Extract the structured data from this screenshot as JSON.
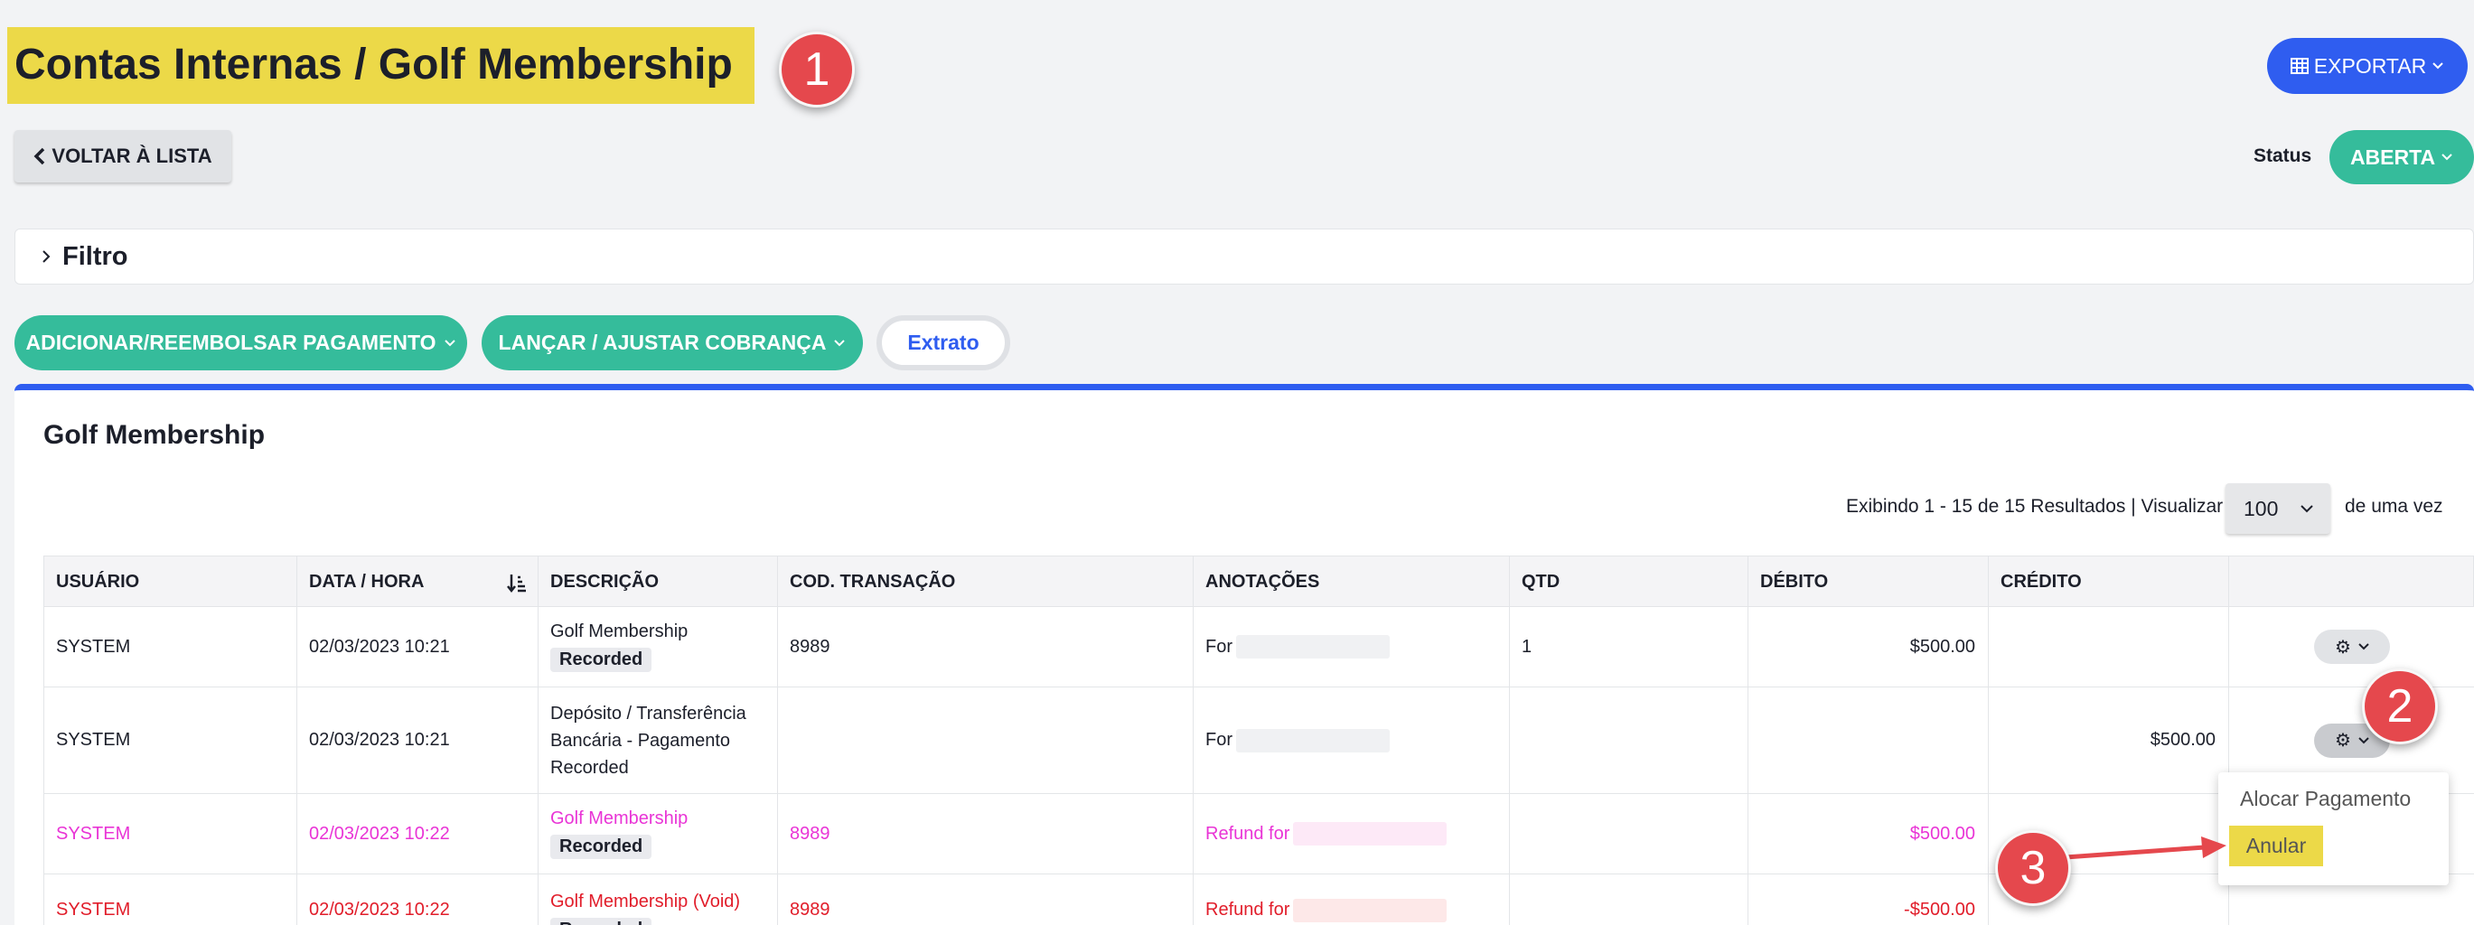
{
  "header": {
    "title": "Contas Internas  / Golf Membership",
    "export_label": "EXPORTAR",
    "back_label": "VOLTAR À LISTA",
    "status_label": "Status",
    "status_value": "ABERTA"
  },
  "filter": {
    "label": "Filtro"
  },
  "actions": {
    "add_payment": "ADICIONAR/REEMBOLSAR PAGAMENTO",
    "post_charge": "LANÇAR / AJUSTAR COBRANÇA",
    "statement": "Extrato"
  },
  "panel": {
    "title": "Golf Membership",
    "pager_text": "Exibindo 1 - 15 de 15 Resultados |  Visualizar",
    "per_page": "100",
    "per_page_suffix": "de uma vez"
  },
  "table": {
    "headers": [
      "USUÁRIO",
      "DATA / HORA",
      "DESCRIÇÃO",
      "COD. TRANSAÇÃO",
      "ANOTAÇÕES",
      "QTD",
      "DÉBITO",
      "CRÉDITO"
    ],
    "rows": [
      {
        "user": "SYSTEM",
        "datetime": "02/03/2023 10:21",
        "description": "Golf Membership",
        "badge": "Recorded",
        "code": "8989",
        "notes": "For",
        "qty": "1",
        "debit": "$500.00",
        "credit": "",
        "color": "normal"
      },
      {
        "user": "SYSTEM",
        "datetime": "02/03/2023 10:21",
        "description": "Depósito / Transferência Bancária - Pagamento Recorded",
        "badge": "",
        "code": "",
        "notes": "For",
        "qty": "",
        "debit": "",
        "credit": "$500.00",
        "color": "normal"
      },
      {
        "user": "SYSTEM",
        "datetime": "02/03/2023 10:22",
        "description": "Golf Membership",
        "badge": "Recorded",
        "code": "8989",
        "notes": "Refund for",
        "qty": "",
        "debit": "$500.00",
        "credit": "",
        "color": "magenta"
      },
      {
        "user": "SYSTEM",
        "datetime": "02/03/2023 10:22",
        "description": "Golf Membership (Void)",
        "badge": "Recorded",
        "code": "8989",
        "notes": "Refund for",
        "qty": "",
        "debit": "-$500.00",
        "credit": "",
        "color": "red"
      }
    ]
  },
  "dropdown": {
    "allocate": "Alocar Pagamento",
    "void": "Anular"
  },
  "markers": [
    "1",
    "2",
    "3"
  ],
  "colors": {
    "accent_blue": "#2f5df0",
    "green": "#35bc9b",
    "highlight_yellow": "#ecd948",
    "marker_red": "#e5484d",
    "magenta": "#e934d6",
    "red": "#e11d2a"
  }
}
